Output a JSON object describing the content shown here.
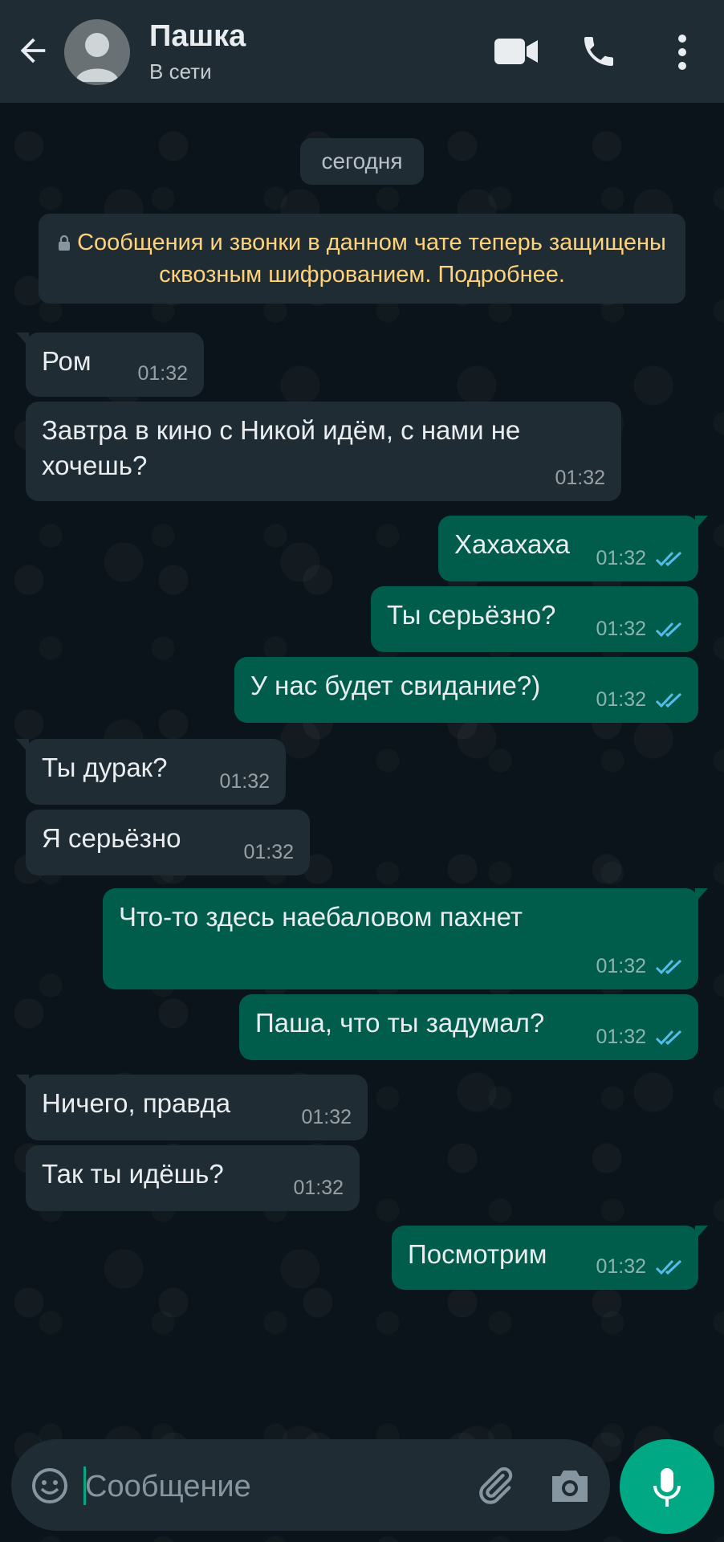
{
  "header": {
    "contact_name": "Пашка",
    "status": "В сети",
    "icons": [
      "back-arrow-icon",
      "avatar",
      "video-call-icon",
      "phone-icon",
      "more-vert-icon"
    ]
  },
  "chat": {
    "date_chip": "сегодня",
    "encryption_notice": "Сообщения и звонки в данном чате теперь защищены сквозным шифрованием. Подробнее.",
    "messages": [
      {
        "direction": "in",
        "text": "Ром",
        "time": "01:32"
      },
      {
        "direction": "in",
        "text": "Завтра в кино с Никой идём, с нами не хочешь?",
        "time": "01:32"
      },
      {
        "direction": "out",
        "text": "Хахахаха",
        "time": "01:32",
        "read": true
      },
      {
        "direction": "out",
        "text": "Ты серьёзно?",
        "time": "01:32",
        "read": true
      },
      {
        "direction": "out",
        "text": "У нас будет свидание?)",
        "time": "01:32",
        "read": true
      },
      {
        "direction": "in",
        "text": "Ты дурак?",
        "time": "01:32"
      },
      {
        "direction": "in",
        "text": "Я серьёзно",
        "time": "01:32"
      },
      {
        "direction": "out",
        "text": "Что-то здесь наебаловом пахнет",
        "time": "01:32",
        "read": true
      },
      {
        "direction": "out",
        "text": "Паша, что ты задумал?",
        "time": "01:32",
        "read": true
      },
      {
        "direction": "in",
        "text": "Ничего, правда",
        "time": "01:32"
      },
      {
        "direction": "in",
        "text": "Так ты идёшь?",
        "time": "01:32"
      },
      {
        "direction": "out",
        "text": "Посмотрим",
        "time": "01:32",
        "read": true
      }
    ]
  },
  "composer": {
    "placeholder": "Сообщение",
    "icons": [
      "emoji-icon",
      "attach-icon",
      "camera-icon",
      "mic-icon"
    ]
  },
  "colors": {
    "background": "#0b141a",
    "header": "#1f2c34",
    "incoming_bubble": "#1f2c34",
    "outgoing_bubble": "#005c4b",
    "read_ticks": "#53bdeb",
    "notice_text": "#ffd279",
    "accent": "#00a884"
  }
}
